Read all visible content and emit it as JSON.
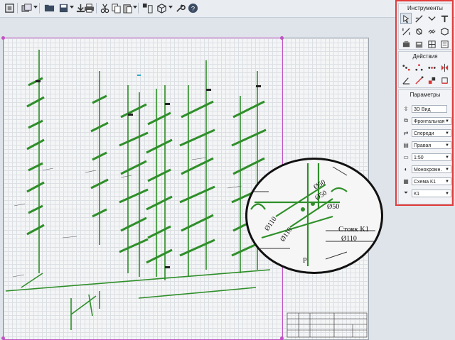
{
  "toolbar": {
    "icons": [
      "frame-icon",
      "view-icon",
      "folder-icon",
      "save-icon",
      "import-icon",
      "print-icon",
      "cut-icon",
      "copy-icon",
      "paste-icon",
      "layers-icon",
      "3d-box-icon",
      "wrench-icon",
      "help-icon"
    ]
  },
  "magnifier": {
    "labels": {
      "d50_a": "Ø50",
      "d50_b": "Ø50",
      "d50_c": "Ø50",
      "d110_a": "Ø110",
      "d110_b": "Ø110",
      "riser": "Стояк К1",
      "d110_c": "Ø110",
      "p": "Р"
    }
  },
  "panel": {
    "tools_title": "Инструменты",
    "actions_title": "Действия",
    "params_title": "Параметры",
    "params": {
      "view": "3D Вид",
      "projection": "Фронтальная",
      "direction": "Спереди",
      "side": "Правая",
      "scale": "1:50",
      "color": "Монохромн.",
      "scheme": "Схема К1",
      "system": "К1"
    }
  },
  "colors": {
    "accent": "#e23b3b",
    "pipe": "#2f8f2a",
    "sheet_border": "#c152c4"
  }
}
